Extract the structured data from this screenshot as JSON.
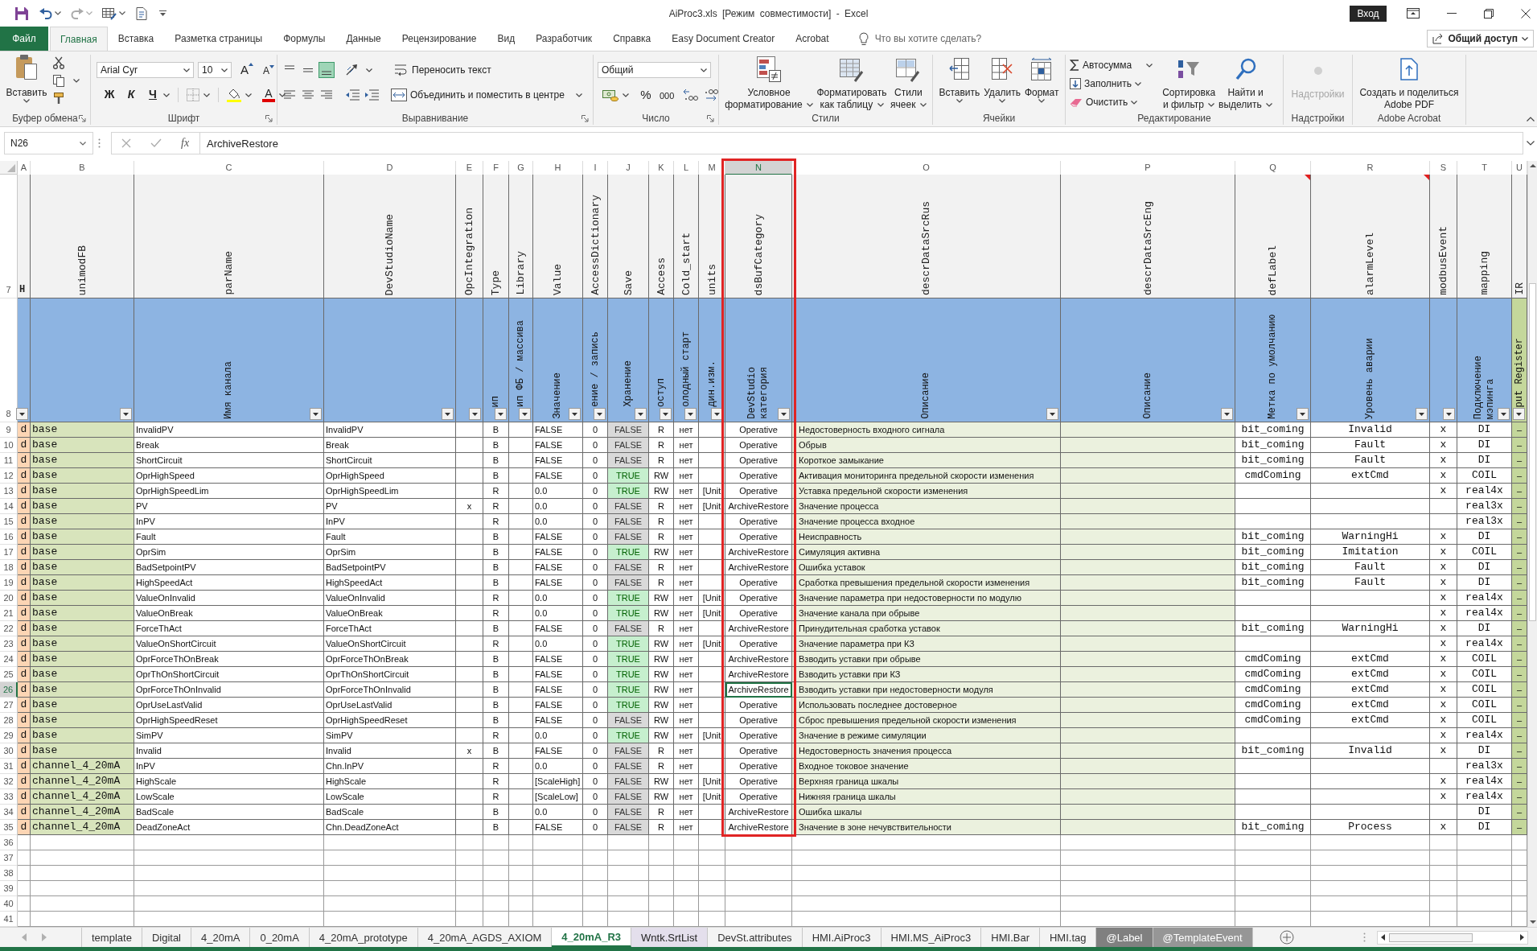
{
  "title_bar": {
    "title": "AiProc3.xls [Режим совместимости] - Excel",
    "sign_in": "Вход"
  },
  "ribbon_tabs": [
    {
      "label": "Файл",
      "kind": "file",
      "selected": false
    },
    {
      "label": "Главная",
      "kind": "tab",
      "selected": true
    },
    {
      "label": "Вставка",
      "kind": "tab",
      "selected": false
    },
    {
      "label": "Разметка страницы",
      "kind": "tab",
      "selected": false
    },
    {
      "label": "Формулы",
      "kind": "tab",
      "selected": false
    },
    {
      "label": "Данные",
      "kind": "tab",
      "selected": false
    },
    {
      "label": "Рецензирование",
      "kind": "tab",
      "selected": false
    },
    {
      "label": "Вид",
      "kind": "tab",
      "selected": false
    },
    {
      "label": "Разработчик",
      "kind": "tab",
      "selected": false
    },
    {
      "label": "Справка",
      "kind": "tab",
      "selected": false
    },
    {
      "label": "Easy Document Creator",
      "kind": "tab",
      "selected": false
    },
    {
      "label": "Acrobat",
      "kind": "tab",
      "selected": false
    }
  ],
  "tell_me": {
    "placeholder": "Что вы хотите сделать?"
  },
  "share": {
    "label": "Общий доступ"
  },
  "ribbon": {
    "clipboard": {
      "label": "Буфер обмена",
      "paste": "Вставить"
    },
    "font": {
      "label": "Шрифт",
      "family": "Arial Cyr",
      "size": "10",
      "grow": "A",
      "shrink": "A",
      "bold": "Ж",
      "italic": "К",
      "underline": "Ч",
      "color_letter": "A"
    },
    "alignment": {
      "label": "Выравнивание",
      "vertical": [
        {
          "selected": false
        },
        {
          "selected": false
        },
        {
          "selected": true
        }
      ],
      "horizontal": [
        {
          "selected": false
        },
        {
          "selected": false
        },
        {
          "selected": false
        }
      ],
      "wrap": "Переносить текст",
      "merge": "Объединить и поместить в центре"
    },
    "number": {
      "label": "Число",
      "format": "Общий",
      "percent": "%",
      "thousands": "000"
    },
    "styles": {
      "label": "Стили",
      "buttons": [
        "Условное\nформатирование",
        "Форматировать\nкак таблицу",
        "Стили\nячеек"
      ]
    },
    "cells": {
      "label": "Ячейки",
      "buttons": [
        "Вставить",
        "Удалить",
        "Формат"
      ]
    },
    "editing": {
      "label": "Редактирование",
      "autosum": "Автосумма",
      "fill": "Заполнить",
      "clear": "Очистить",
      "sort": "Сортировка\nи фильтр",
      "find": "Найти и\nвыделить"
    },
    "addins": {
      "label": "Надстройки",
      "button": "Надстройки",
      "disabled": true
    },
    "acrobat": {
      "label": "Adobe Acrobat",
      "button": "Создать и поделиться\nAdobe PDF"
    }
  },
  "formula_bar": {
    "name_box": "N26",
    "fx": "fx",
    "formula": "ArchiveRestore"
  },
  "columns": [
    {
      "letter": "A",
      "title": "H",
      "upright": true,
      "selected": false,
      "highlighted": false,
      "comment": false
    },
    {
      "letter": "B",
      "title": "unimodFB",
      "upright": false,
      "selected": false,
      "highlighted": false,
      "comment": false
    },
    {
      "letter": "C",
      "title": "parName",
      "caption": "Имя канала",
      "upright": false,
      "selected": false,
      "highlighted": false,
      "comment": false
    },
    {
      "letter": "D",
      "title": "DevStudioName",
      "upright": false,
      "selected": false,
      "highlighted": false,
      "comment": false
    },
    {
      "letter": "E",
      "title": "OpcIntegration",
      "upright": false,
      "selected": false,
      "highlighted": false,
      "comment": false
    },
    {
      "letter": "F",
      "title": "Type",
      "caption": "ип",
      "upright": false,
      "selected": false,
      "highlighted": false,
      "comment": false
    },
    {
      "letter": "G",
      "title": "Library",
      "caption": "ип ФБ / массива",
      "upright": false,
      "selected": false,
      "highlighted": false,
      "comment": false
    },
    {
      "letter": "H",
      "title": "Value",
      "caption": "Значение",
      "upright": false,
      "selected": false,
      "highlighted": false,
      "comment": false
    },
    {
      "letter": "I",
      "title": "AccessDictionary",
      "caption": "ение / запись",
      "upright": false,
      "selected": false,
      "highlighted": false,
      "comment": false
    },
    {
      "letter": "J",
      "title": "Save",
      "caption": "Хранение",
      "upright": false,
      "selected": false,
      "highlighted": false,
      "comment": false
    },
    {
      "letter": "K",
      "title": "Access",
      "caption": "оступ",
      "upright": false,
      "selected": false,
      "highlighted": false,
      "comment": false
    },
    {
      "letter": "L",
      "title": "Cold_start",
      "caption": "олодный старт",
      "upright": false,
      "selected": false,
      "highlighted": false,
      "comment": false
    },
    {
      "letter": "M",
      "title": "units",
      "caption": "дин.изм.",
      "upright": false,
      "selected": false,
      "highlighted": false,
      "comment": false
    },
    {
      "letter": "N",
      "title": "dsBufCategory",
      "caption": "DevStudio\nкатегория",
      "upright": false,
      "selected": true,
      "highlighted": true,
      "comment": false
    },
    {
      "letter": "O",
      "title": "descrDataSrcRus",
      "caption": "Описание",
      "upright": false,
      "selected": false,
      "highlighted": false,
      "comment": false
    },
    {
      "letter": "P",
      "title": "descrDataSrcEng",
      "caption": "Описание",
      "upright": false,
      "selected": false,
      "highlighted": false,
      "comment": false
    },
    {
      "letter": "Q",
      "title": "defLabel",
      "caption": "Метка по умолчанию",
      "upright": false,
      "selected": false,
      "highlighted": false,
      "comment": true
    },
    {
      "letter": "R",
      "title": "alarmLevel",
      "caption": "Уровень аварии",
      "upright": false,
      "selected": false,
      "highlighted": false,
      "comment": true
    },
    {
      "letter": "S",
      "title": "modbusEvent",
      "upright": false,
      "selected": false,
      "highlighted": false,
      "comment": false
    },
    {
      "letter": "T",
      "title": "mapping",
      "caption": "Подключение\nмэпинга",
      "upright": false,
      "selected": false,
      "highlighted": false,
      "comment": false
    },
    {
      "letter": "U",
      "title": "IR",
      "caption": "put Register",
      "upright": false,
      "selected": false,
      "highlighted": false,
      "comment": false
    }
  ],
  "header_rows": [
    {
      "number": "7",
      "selected": false
    },
    {
      "number": "8",
      "selected": false
    }
  ],
  "rows": [
    {
      "number": "9",
      "selected": false,
      "save_enabled": false,
      "cells": {
        "A": "d",
        "B": "base",
        "C": "InvalidPV",
        "D": "InvalidPV",
        "F": "B",
        "H": "FALSE",
        "I": "0",
        "J": "FALSE",
        "K": "R",
        "L": "нет",
        "N": "Operative",
        "O": "Недостоверность входного сигнала",
        "Q": "bit_coming",
        "R": "Invalid",
        "S": "x",
        "T": "DI",
        "U": "–"
      }
    },
    {
      "number": "10",
      "selected": false,
      "save_enabled": false,
      "cells": {
        "A": "d",
        "B": "base",
        "C": "Break",
        "D": "Break",
        "F": "B",
        "H": "FALSE",
        "I": "0",
        "J": "FALSE",
        "K": "R",
        "L": "нет",
        "N": "Operative",
        "O": "Обрыв",
        "Q": "bit_coming",
        "R": "Fault",
        "S": "x",
        "T": "DI",
        "U": "–"
      }
    },
    {
      "number": "11",
      "selected": false,
      "save_enabled": false,
      "cells": {
        "A": "d",
        "B": "base",
        "C": "ShortCircuit",
        "D": "ShortCircuit",
        "F": "B",
        "H": "FALSE",
        "I": "0",
        "J": "FALSE",
        "K": "R",
        "L": "нет",
        "N": "Operative",
        "O": "Короткое замыкание",
        "Q": "bit_coming",
        "R": "Fault",
        "S": "x",
        "T": "DI",
        "U": "–"
      }
    },
    {
      "number": "12",
      "selected": false,
      "save_enabled": true,
      "cells": {
        "A": "d",
        "B": "base",
        "C": "OprHighSpeed",
        "D": "OprHighSpeed",
        "F": "B",
        "H": "FALSE",
        "I": "0",
        "J": "TRUE",
        "K": "RW",
        "L": "нет",
        "N": "Operative",
        "O": "Активация мониторинга предельной скорости изменения",
        "Q": "cmdComing",
        "R": "extCmd",
        "S": "x",
        "T": "COIL",
        "U": "–"
      }
    },
    {
      "number": "13",
      "selected": false,
      "save_enabled": true,
      "cells": {
        "A": "d",
        "B": "base",
        "C": "OprHighSpeedLim",
        "D": "OprHighSpeedLim",
        "F": "R",
        "H": "0.0",
        "I": "0",
        "J": "TRUE",
        "K": "RW",
        "L": "нет",
        "M": "[Unit",
        "N": "Operative",
        "O": "Уставка предельной скорости изменения",
        "S": "x",
        "T": "real4x",
        "U": "–"
      }
    },
    {
      "number": "14",
      "selected": false,
      "save_enabled": false,
      "cells": {
        "A": "d",
        "B": "base",
        "C": "PV",
        "D": "PV",
        "E": "x",
        "F": "R",
        "H": "0.0",
        "I": "0",
        "J": "FALSE",
        "K": "R",
        "L": "нет",
        "M": "[Unit",
        "N": "ArchiveRestore",
        "O": "Значение процесса",
        "T": "real3x",
        "U": "–"
      }
    },
    {
      "number": "15",
      "selected": false,
      "save_enabled": false,
      "cells": {
        "A": "d",
        "B": "base",
        "C": "InPV",
        "D": "InPV",
        "F": "R",
        "H": "0.0",
        "I": "0",
        "J": "FALSE",
        "K": "R",
        "L": "нет",
        "N": "Operative",
        "O": "Значение процесса входное",
        "T": "real3x",
        "U": "–"
      }
    },
    {
      "number": "16",
      "selected": false,
      "save_enabled": false,
      "cells": {
        "A": "d",
        "B": "base",
        "C": "Fault",
        "D": "Fault",
        "F": "B",
        "H": "FALSE",
        "I": "0",
        "J": "FALSE",
        "K": "R",
        "L": "нет",
        "N": "Operative",
        "O": "Неисправность",
        "Q": "bit_coming",
        "R": "WarningHi",
        "S": "x",
        "T": "DI",
        "U": "–"
      }
    },
    {
      "number": "17",
      "selected": false,
      "save_enabled": true,
      "cells": {
        "A": "d",
        "B": "base",
        "C": "OprSim",
        "D": "OprSim",
        "F": "B",
        "H": "FALSE",
        "I": "0",
        "J": "TRUE",
        "K": "RW",
        "L": "нет",
        "N": "ArchiveRestore",
        "O": "Симуляция активна",
        "Q": "bit_coming",
        "R": "Imitation",
        "S": "x",
        "T": "COIL",
        "U": "–"
      }
    },
    {
      "number": "18",
      "selected": false,
      "save_enabled": false,
      "cells": {
        "A": "d",
        "B": "base",
        "C": "BadSetpointPV",
        "D": "BadSetpointPV",
        "F": "B",
        "H": "FALSE",
        "I": "0",
        "J": "FALSE",
        "K": "R",
        "L": "нет",
        "N": "ArchiveRestore",
        "O": "Ошибка уставок",
        "Q": "bit_coming",
        "R": "Fault",
        "S": "x",
        "T": "DI",
        "U": "–"
      }
    },
    {
      "number": "19",
      "selected": false,
      "save_enabled": false,
      "cells": {
        "A": "d",
        "B": "base",
        "C": "HighSpeedAct",
        "D": "HighSpeedAct",
        "F": "B",
        "H": "FALSE",
        "I": "0",
        "J": "FALSE",
        "K": "R",
        "L": "нет",
        "N": "Operative",
        "O": "Сработка превышения предельной скорости изменения",
        "Q": "bit_coming",
        "R": "Fault",
        "S": "x",
        "T": "DI",
        "U": "–"
      }
    },
    {
      "number": "20",
      "selected": false,
      "save_enabled": true,
      "cells": {
        "A": "d",
        "B": "base",
        "C": "ValueOnInvalid",
        "D": "ValueOnInvalid",
        "F": "R",
        "H": "0.0",
        "I": "0",
        "J": "TRUE",
        "K": "RW",
        "L": "нет",
        "M": "[Unit",
        "N": "Operative",
        "O": "Значение параметра при недостоверности по модулю",
        "S": "x",
        "T": "real4x",
        "U": "–"
      }
    },
    {
      "number": "21",
      "selected": false,
      "save_enabled": true,
      "cells": {
        "A": "d",
        "B": "base",
        "C": "ValueOnBreak",
        "D": "ValueOnBreak",
        "F": "R",
        "H": "0.0",
        "I": "0",
        "J": "TRUE",
        "K": "RW",
        "L": "нет",
        "M": "[Unit",
        "N": "Operative",
        "O": "Значение канала при обрыве",
        "S": "x",
        "T": "real4x",
        "U": "–"
      }
    },
    {
      "number": "22",
      "selected": false,
      "save_enabled": false,
      "cells": {
        "A": "d",
        "B": "base",
        "C": "ForceThAct",
        "D": "ForceThAct",
        "F": "B",
        "H": "FALSE",
        "I": "0",
        "J": "FALSE",
        "K": "R",
        "L": "нет",
        "N": "ArchiveRestore",
        "O": "Принудительная сработка уставок",
        "Q": "bit_coming",
        "R": "WarningHi",
        "S": "x",
        "T": "DI",
        "U": "–"
      }
    },
    {
      "number": "23",
      "selected": false,
      "save_enabled": true,
      "cells": {
        "A": "d",
        "B": "base",
        "C": "ValueOnShortCircuit",
        "D": "ValueOnShortCircuit",
        "F": "R",
        "H": "0.0",
        "I": "0",
        "J": "TRUE",
        "K": "RW",
        "L": "нет",
        "M": "[Unit",
        "N": "Operative",
        "O": "Значение параметра при КЗ",
        "S": "x",
        "T": "real4x",
        "U": "–"
      }
    },
    {
      "number": "24",
      "selected": false,
      "save_enabled": true,
      "cells": {
        "A": "d",
        "B": "base",
        "C": "OprForceThOnBreak",
        "D": "OprForceThOnBreak",
        "F": "B",
        "H": "FALSE",
        "I": "0",
        "J": "TRUE",
        "K": "RW",
        "L": "нет",
        "N": "ArchiveRestore",
        "O": "Взводить уставки при обрыве",
        "Q": "cmdComing",
        "R": "extCmd",
        "S": "x",
        "T": "COIL",
        "U": "–"
      }
    },
    {
      "number": "25",
      "selected": false,
      "save_enabled": true,
      "cells": {
        "A": "d",
        "B": "base",
        "C": "OprThOnShortCircuit",
        "D": "OprThOnShortCircuit",
        "F": "B",
        "H": "FALSE",
        "I": "0",
        "J": "TRUE",
        "K": "RW",
        "L": "нет",
        "N": "ArchiveRestore",
        "O": "Взводить уставки при КЗ",
        "Q": "cmdComing",
        "R": "extCmd",
        "S": "x",
        "T": "COIL",
        "U": "–"
      }
    },
    {
      "number": "26",
      "selected": true,
      "save_enabled": true,
      "cells": {
        "A": "d",
        "B": "base",
        "C": "OprForceThOnInvalid",
        "D": "OprForceThOnInvalid",
        "F": "B",
        "H": "FALSE",
        "I": "0",
        "J": "TRUE",
        "K": "RW",
        "L": "нет",
        "N": "ArchiveRestore",
        "O": "Взводить уставки при недостоверности модуля",
        "Q": "cmdComing",
        "R": "extCmd",
        "S": "x",
        "T": "COIL",
        "U": "–"
      }
    },
    {
      "number": "27",
      "selected": false,
      "save_enabled": true,
      "cells": {
        "A": "d",
        "B": "base",
        "C": "OprUseLastValid",
        "D": "OprUseLastValid",
        "F": "B",
        "H": "FALSE",
        "I": "0",
        "J": "TRUE",
        "K": "RW",
        "L": "нет",
        "N": "Operative",
        "O": "Использовать последнее достоверное",
        "Q": "cmdComing",
        "R": "extCmd",
        "S": "x",
        "T": "COIL",
        "U": "–"
      }
    },
    {
      "number": "28",
      "selected": false,
      "save_enabled": false,
      "cells": {
        "A": "d",
        "B": "base",
        "C": "OprHighSpeedReset",
        "D": "OprHighSpeedReset",
        "F": "B",
        "H": "FALSE",
        "I": "0",
        "J": "FALSE",
        "K": "RW",
        "L": "нет",
        "N": "Operative",
        "O": "Сброс превышения предельной скорости изменения",
        "Q": "cmdComing",
        "R": "extCmd",
        "S": "x",
        "T": "COIL",
        "U": "–"
      }
    },
    {
      "number": "29",
      "selected": false,
      "save_enabled": true,
      "cells": {
        "A": "d",
        "B": "base",
        "C": "SimPV",
        "D": "SimPV",
        "F": "R",
        "H": "0.0",
        "I": "0",
        "J": "TRUE",
        "K": "RW",
        "L": "нет",
        "M": "[Unit",
        "N": "Operative",
        "O": "Значение в режиме симуляции",
        "S": "x",
        "T": "real4x",
        "U": "–"
      }
    },
    {
      "number": "30",
      "selected": false,
      "save_enabled": false,
      "cells": {
        "A": "d",
        "B": "base",
        "C": "Invalid",
        "D": "Invalid",
        "E": "x",
        "F": "B",
        "H": "FALSE",
        "I": "0",
        "J": "FALSE",
        "K": "R",
        "L": "нет",
        "N": "Operative",
        "O": "Недостоверность значения процесса",
        "Q": "bit_coming",
        "R": "Invalid",
        "S": "x",
        "T": "DI",
        "U": "–"
      }
    },
    {
      "number": "31",
      "selected": false,
      "save_enabled": false,
      "cells": {
        "A": "d",
        "B": "channel_4_20mA",
        "C": "InPV",
        "D": "Chn.InPV",
        "F": "R",
        "H": "0.0",
        "I": "0",
        "J": "FALSE",
        "K": "R",
        "L": "нет",
        "N": "Operative",
        "O": "Входное токовое значение",
        "T": "real3x",
        "U": "–"
      }
    },
    {
      "number": "32",
      "selected": false,
      "save_enabled": false,
      "cells": {
        "A": "d",
        "B": "channel_4_20mA",
        "C": "HighScale",
        "D": "HighScale",
        "F": "R",
        "H": "[ScaleHigh]",
        "I": "0",
        "J": "FALSE",
        "K": "RW",
        "L": "нет",
        "M": "[Unit",
        "N": "Operative",
        "O": "Верхняя граница шкалы",
        "S": "x",
        "T": "real4x",
        "U": "–"
      }
    },
    {
      "number": "33",
      "selected": false,
      "save_enabled": false,
      "cells": {
        "A": "d",
        "B": "channel_4_20mA",
        "C": "LowScale",
        "D": "LowScale",
        "F": "R",
        "H": "[ScaleLow]",
        "I": "0",
        "J": "FALSE",
        "K": "RW",
        "L": "нет",
        "M": "[Unit",
        "N": "Operative",
        "O": "Нижняя граница шкалы",
        "S": "x",
        "T": "real4x",
        "U": "–"
      }
    },
    {
      "number": "34",
      "selected": false,
      "save_enabled": false,
      "cells": {
        "A": "d",
        "B": "channel_4_20mA",
        "C": "BadScale",
        "D": "BadScale",
        "F": "B",
        "H": "0.0",
        "I": "0",
        "J": "FALSE",
        "K": "R",
        "L": "нет",
        "N": "ArchiveRestore",
        "O": "Ошибка шкалы",
        "T": "DI",
        "U": "–"
      }
    },
    {
      "number": "35",
      "selected": false,
      "save_enabled": false,
      "cells": {
        "A": "d",
        "B": "channel_4_20mA",
        "C": "DeadZoneAct",
        "D": "Chn.DeadZoneAct",
        "F": "B",
        "H": "FALSE",
        "I": "0",
        "J": "FALSE",
        "K": "R",
        "L": "нет",
        "N": "ArchiveRestore",
        "O": "Значение в зоне нечувствительности",
        "Q": "bit_coming",
        "R": "Process",
        "S": "x",
        "T": "DI",
        "U": "–"
      }
    },
    {
      "number": "36",
      "selected": false
    },
    {
      "number": "37",
      "selected": false
    },
    {
      "number": "38",
      "selected": false
    },
    {
      "number": "39",
      "selected": false
    },
    {
      "number": "40",
      "selected": false
    },
    {
      "number": "41",
      "selected": false
    }
  ],
  "sheet_tabs": [
    {
      "label": "template",
      "selected": false
    },
    {
      "label": "Digital",
      "selected": false
    },
    {
      "label": "4_20mA",
      "selected": false
    },
    {
      "label": "0_20mA",
      "selected": false
    },
    {
      "label": "4_20mA_prototype",
      "selected": false
    },
    {
      "label": "4_20mA_AGDS_AXIOM",
      "selected": false
    },
    {
      "label": "4_20mA_R3",
      "selected": true
    },
    {
      "label": "Wntk.SrtList",
      "selected": false,
      "color": "#e4dfec"
    },
    {
      "label": "DevSt.attributes",
      "selected": false
    },
    {
      "label": "HMI.AiProc3",
      "selected": false
    },
    {
      "label": "HMI.MS_AiProc3",
      "selected": false
    },
    {
      "label": "HMI.Bar",
      "selected": false
    },
    {
      "label": "HMI.tag",
      "selected": false
    },
    {
      "label": "@Label",
      "selected": false,
      "color": "#808080"
    },
    {
      "label": "@TemplateEvent",
      "selected": false,
      "color": "#969696"
    }
  ]
}
